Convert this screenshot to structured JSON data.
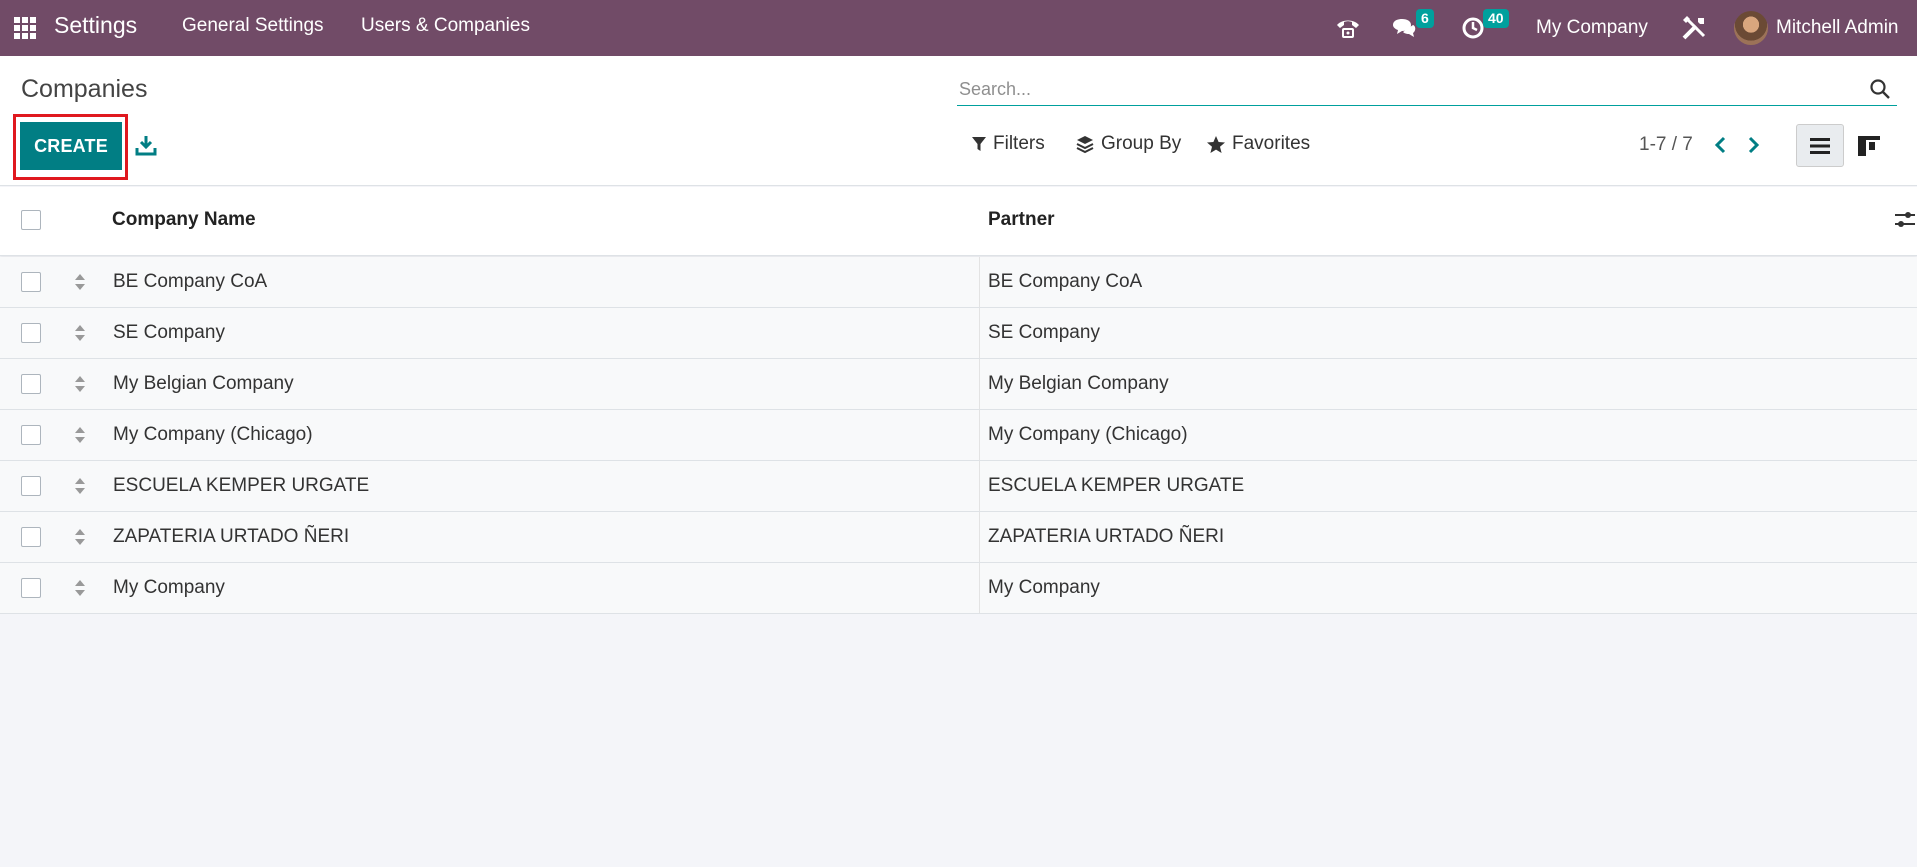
{
  "navbar": {
    "app_title": "Settings",
    "menus": [
      "General Settings",
      "Users & Companies"
    ],
    "messages_count": "6",
    "activities_count": "40",
    "company": "My Company",
    "user": "Mitchell Admin"
  },
  "control_panel": {
    "title": "Companies",
    "search_placeholder": "Search...",
    "create_label": "CREATE",
    "filters_label": "Filters",
    "group_by_label": "Group By",
    "favorites_label": "Favorites",
    "pager": "1-7 / 7"
  },
  "table": {
    "headers": [
      "Company Name",
      "Partner"
    ],
    "rows": [
      {
        "name": "BE Company CoA",
        "partner": "BE Company CoA"
      },
      {
        "name": "SE Company",
        "partner": "SE Company"
      },
      {
        "name": "My Belgian Company",
        "partner": "My Belgian Company"
      },
      {
        "name": "My Company (Chicago)",
        "partner": "My Company (Chicago)"
      },
      {
        "name": "ESCUELA KEMPER URGATE",
        "partner": "ESCUELA KEMPER URGATE"
      },
      {
        "name": "ZAPATERIA URTADO ÑERI",
        "partner": "ZAPATERIA URTADO ÑERI"
      },
      {
        "name": "My Company",
        "partner": "My Company"
      }
    ]
  },
  "colors": {
    "navbar": "#714b67",
    "primary": "#017e84",
    "badge": "#00a09d",
    "highlight": "#e0181f"
  },
  "icons": [
    "apps-grid-icon",
    "phone-icon",
    "chat-icon",
    "clock-icon",
    "tools-icon",
    "search-icon",
    "download-icon",
    "filter-icon",
    "layers-icon",
    "star-icon",
    "chevron-left-icon",
    "chevron-right-icon",
    "list-view-icon",
    "kanban-view-icon",
    "drag-handle-icon",
    "column-settings-icon"
  ]
}
